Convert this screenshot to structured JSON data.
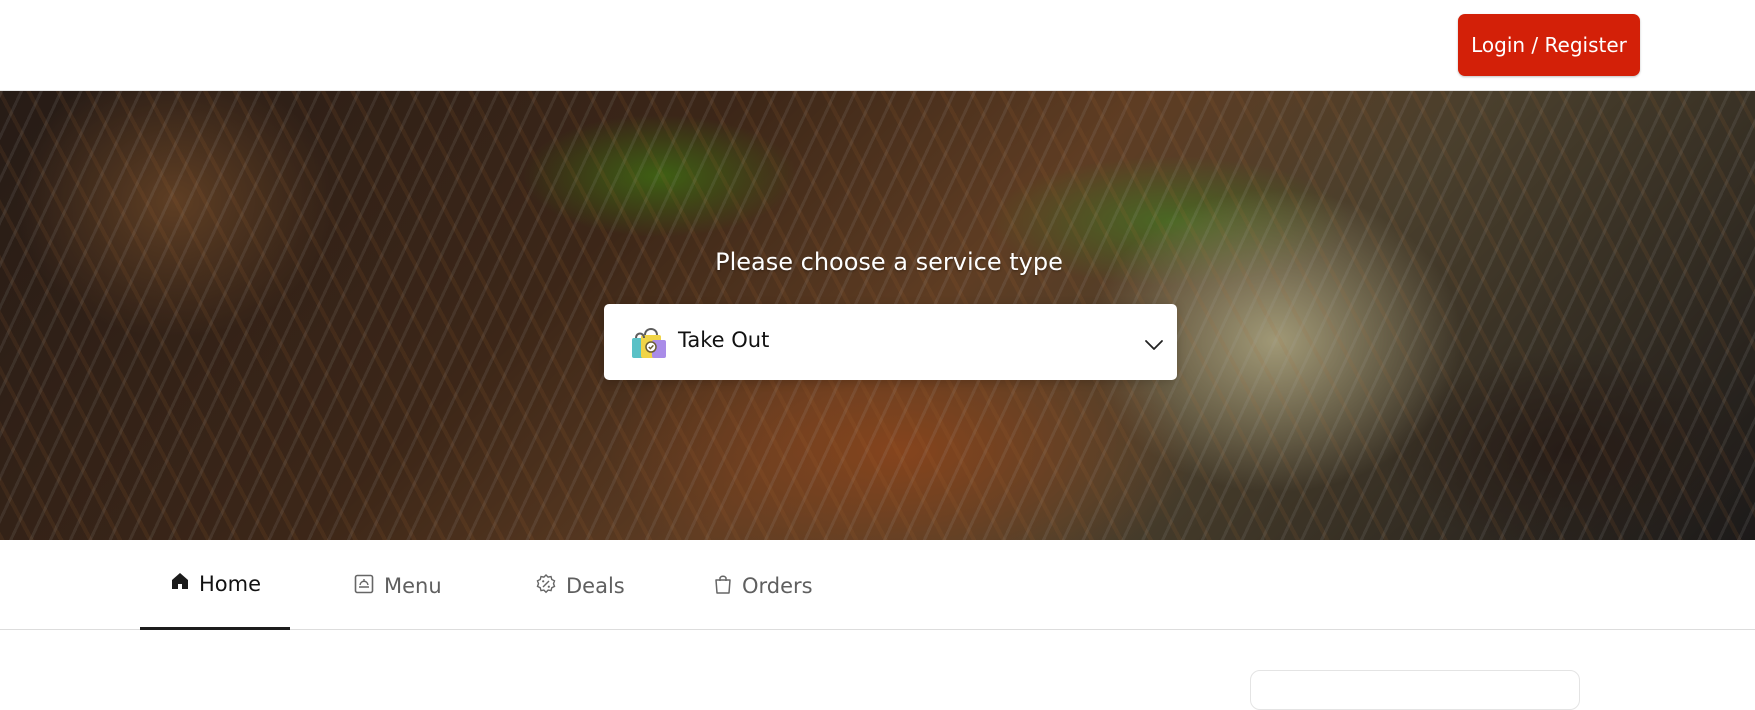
{
  "header": {
    "login_label": "Login / Register"
  },
  "hero": {
    "title": "Please choose a service type",
    "selected_service": "Take Out",
    "service_icon": "shopping-bag-icon",
    "dropdown_icon": "chevron-down-icon"
  },
  "nav": {
    "tabs": [
      {
        "label": "Home",
        "icon": "home-icon",
        "active": true
      },
      {
        "label": "Menu",
        "icon": "menu-icon",
        "active": false
      },
      {
        "label": "Deals",
        "icon": "deal-badge-icon",
        "active": false
      },
      {
        "label": "Orders",
        "icon": "shopping-bag-icon",
        "active": false
      }
    ]
  },
  "colors": {
    "accent": "#d32008",
    "active_tab_text": "#121212",
    "inactive_tab_text": "#5f5f5f",
    "white": "#ffffff"
  }
}
